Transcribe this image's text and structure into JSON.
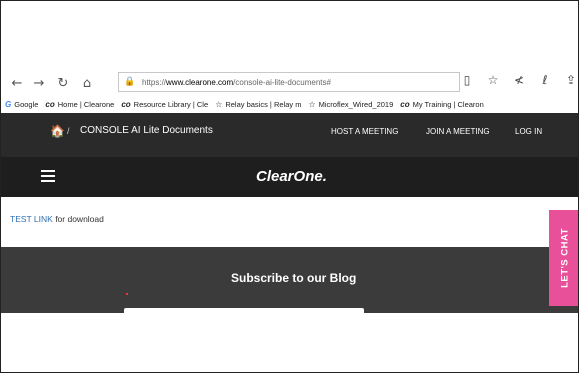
{
  "browser": {
    "nav": {
      "back": "←",
      "forward": "→",
      "refresh": "↻",
      "home": "⌂"
    },
    "address": {
      "lock": "🔒",
      "prefix": "https://",
      "domain": "www.clearone.com",
      "path": "/console-ai-lite-documents#"
    },
    "right_icons": [
      "▯",
      "☆",
      "≮",
      "ℓ",
      "⇪"
    ],
    "bookmarks": [
      {
        "icon": "G",
        "label": "Google"
      },
      {
        "icon": "co",
        "label": "Home | Clearone"
      },
      {
        "icon": "co",
        "label": "Resource Library | Cle"
      },
      {
        "icon": "☆",
        "label": "Relay basics | Relay m"
      },
      {
        "icon": "☆",
        "label": "Microflex_Wired_2019"
      },
      {
        "icon": "co",
        "label": "My Training | Clearon"
      }
    ]
  },
  "site": {
    "topbar": {
      "home_icon": "🏠",
      "separator": "/",
      "breadcrumb": "CONSOLE AI Lite Documents",
      "links": {
        "host": "HOST A MEETING",
        "join": "JOIN A MEETING",
        "login": "LOG IN"
      }
    },
    "logo": "ClearOne.",
    "content": {
      "link": "TEST LINK",
      "text": " for download"
    },
    "subscribe": {
      "title": "Subscribe to our Blog"
    },
    "chat": {
      "label": "LET'S CHAT"
    }
  }
}
